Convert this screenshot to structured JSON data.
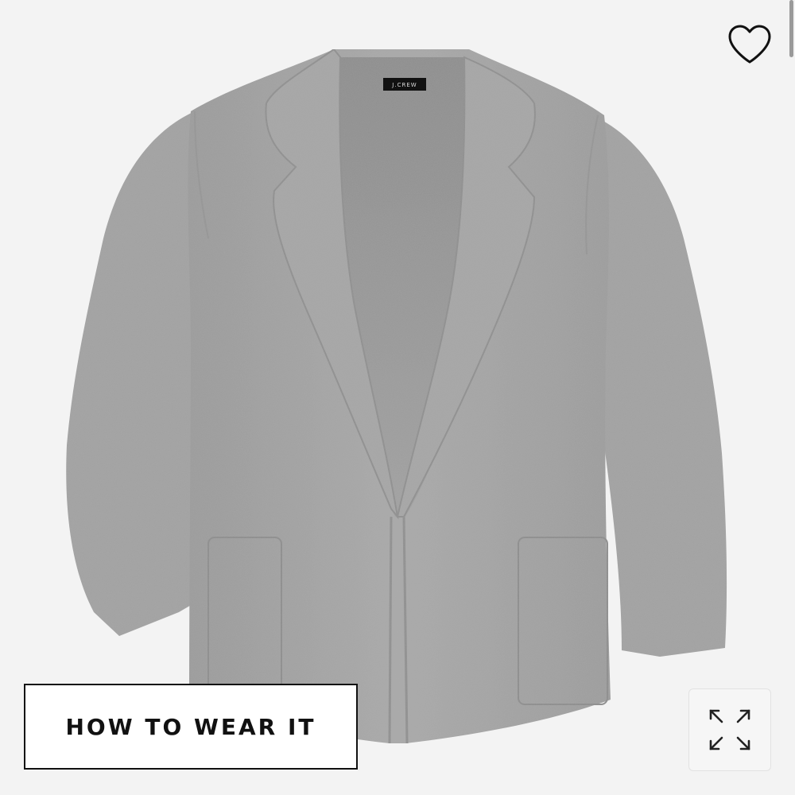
{
  "product": {
    "image_alt": "Gray knit sweater-blazer",
    "brand_label": "J.CREW"
  },
  "actions": {
    "how_to_wear_label": "HOW TO WEAR IT",
    "wishlist_icon": "heart-outline-icon",
    "expand_icon": "expand-arrows-icon"
  },
  "colors": {
    "background": "#f3f3f3",
    "garment": "#a3a3a3",
    "text": "#111111"
  }
}
